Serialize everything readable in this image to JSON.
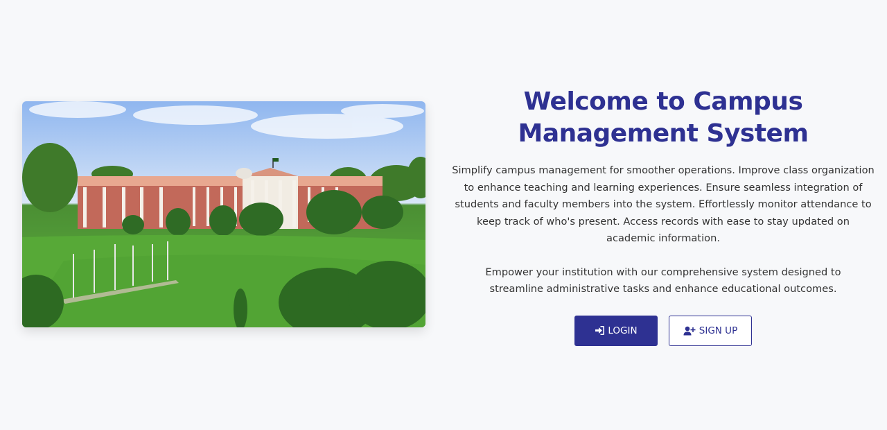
{
  "hero": {
    "image_alt": "University campus building with green lawn"
  },
  "welcome": {
    "title_line1": "Welcome to Campus",
    "title_line2": "Management System",
    "paragraph1": "Simplify campus management for smoother operations. Improve class organization to enhance teaching and learning experiences. Ensure seamless integration of students and faculty members into the system. Effortlessly monitor attendance to keep track of who's present. Access records with ease to stay updated on academic information.",
    "paragraph2": "Empower your institution with our comprehensive system designed to streamline administrative tasks and enhance educational outcomes."
  },
  "actions": {
    "login_label": "LOGIN",
    "login_icon": "sign-in-icon",
    "signup_label": "SIGN UP",
    "signup_icon": "user-plus-icon"
  },
  "colors": {
    "brand": "#2e3192",
    "background": "#f7f8fa",
    "text": "#333333"
  }
}
